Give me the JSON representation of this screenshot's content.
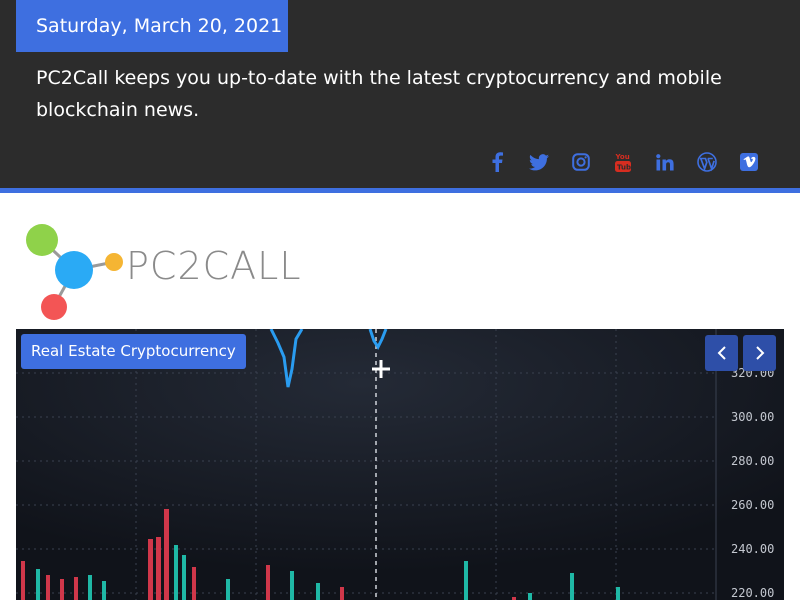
{
  "header": {
    "date": "Saturday, March 20, 2021",
    "tagline": "PC2Call keeps you up-to-date with the latest cryptocurrency and mobile blockchain news.",
    "social_icons": [
      "facebook-icon",
      "twitter-icon",
      "instagram-icon",
      "youtube-icon",
      "linkedin-icon",
      "wordpress-icon",
      "vimeo-icon"
    ]
  },
  "logo": {
    "text": "PC2CALL",
    "dot_colors": [
      "#8fd24a",
      "#2aaaf5",
      "#f5b533",
      "#f35555"
    ]
  },
  "slider": {
    "category": "Real Estate Cryptocurrency",
    "axis_labels": [
      "320.00",
      "300.00",
      "280.00",
      "260.00",
      "240.00",
      "220.00"
    ],
    "prev_icon": "chevron-left-icon",
    "next_icon": "chevron-right-icon"
  },
  "colors": {
    "accent": "#3e6fe0",
    "header_bg": "#2c2c2c",
    "social_icon": "#3e6fe0",
    "youtube_icon": "#d62d20"
  }
}
